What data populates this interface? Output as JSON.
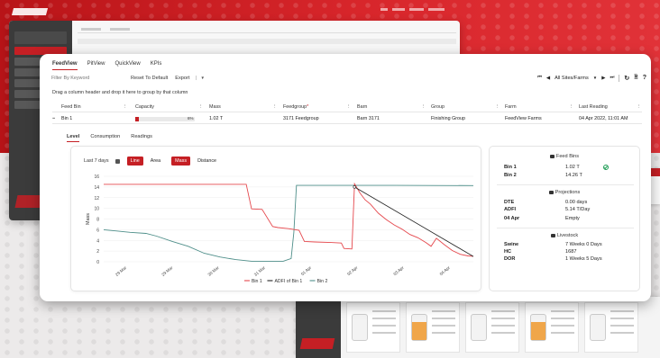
{
  "brand": {
    "accent": "#c51f24"
  },
  "tabs": [
    {
      "label": "FeedView",
      "active": true
    },
    {
      "label": "PitView",
      "active": false
    },
    {
      "label": "QuickView",
      "active": false
    },
    {
      "label": "KPIs",
      "active": false
    }
  ],
  "toolbar": {
    "filter_placeholder": "Filter By Keyword",
    "reset_label": "Reset To Default",
    "export_label": "Export",
    "export_caret": "▼",
    "first_icon": "⏮",
    "prev_icon": "◀",
    "site_label": "All Sites/Farms",
    "site_caret": "▼",
    "next_icon": "▶",
    "last_icon": "⏭",
    "refresh_icon": "↻",
    "file_icon": "🗎",
    "help_icon": "?"
  },
  "group_hint": "Drag a column header and drop it here to group by that column",
  "grid": {
    "headers": [
      "Feed Bin",
      "Capacity",
      "Mass",
      "Feedgroup",
      "Barn",
      "Group",
      "Farm",
      "Last Reading"
    ],
    "required_marker": "*",
    "row": {
      "expand_icon": "−",
      "feed_bin": "Bin 1",
      "capacity_pct": 6,
      "capacity_text": "6%",
      "mass": "1.02 T",
      "feedgroup": "3171 Feedgroup",
      "barn": "Barn 3171",
      "group": "Finishing Group",
      "farm": "FeedView Farms",
      "last_reading": "04 Apr 2022, 11:01 AM"
    }
  },
  "sub_tabs": [
    {
      "label": "Level",
      "active": true
    },
    {
      "label": "Consumption",
      "active": false
    },
    {
      "label": "Readings",
      "active": false
    }
  ],
  "chart_controls": {
    "range": "Last 7 days",
    "line_label": "Line",
    "area_label": "Area",
    "mass_label": "Mass",
    "distance_label": "Distance"
  },
  "chart_data": {
    "type": "line",
    "ylabel": "Mass",
    "xlabel": "",
    "ylim": [
      0,
      16
    ],
    "yticks": [
      0,
      2,
      4,
      6,
      8,
      10,
      12,
      14,
      16
    ],
    "x_ticks": [
      "29 Mar",
      "29 Mar",
      "30 Mar",
      "31 Mar",
      "01 Apr",
      "02 Apr",
      "03 Apr",
      "04 Apr"
    ],
    "x_range": [
      0,
      7
    ],
    "grid": true,
    "legend_position": "bottom",
    "series": [
      {
        "name": "Bin 1",
        "color": "#e5484d",
        "x": [
          0.0,
          2.7,
          2.8,
          3.0,
          3.2,
          3.3,
          3.5,
          3.7,
          3.8,
          4.0,
          4.3,
          4.5,
          4.55,
          4.7,
          4.75,
          4.85,
          4.95,
          5.05,
          5.2,
          5.35,
          5.5,
          5.65,
          5.8,
          5.95,
          6.1,
          6.2,
          6.3,
          6.45,
          6.6,
          6.75,
          6.9,
          7.0
        ],
        "y": [
          14.5,
          14.5,
          9.9,
          9.8,
          6.6,
          6.4,
          6.2,
          5.9,
          3.8,
          3.7,
          3.6,
          3.5,
          2.5,
          2.4,
          14.6,
          12.9,
          11.6,
          10.8,
          9.1,
          7.9,
          6.9,
          6.1,
          5.1,
          4.5,
          3.6,
          2.9,
          4.4,
          3.2,
          2.1,
          1.4,
          1.1,
          1.02
        ]
      },
      {
        "name": "ADFI of Bin 1",
        "color": "#222222",
        "x": [
          4.75,
          7.0
        ],
        "y": [
          14.0,
          1.0
        ]
      },
      {
        "name": "Bin 2",
        "color": "#4f8f8a",
        "x": [
          0.0,
          0.5,
          0.8,
          1.0,
          1.3,
          1.6,
          1.9,
          2.2,
          2.5,
          2.8,
          3.05,
          3.2,
          3.4,
          3.55,
          3.6,
          3.65,
          4.0,
          5.5,
          7.0
        ],
        "y": [
          6.0,
          5.5,
          5.3,
          4.8,
          3.8,
          2.9,
          1.6,
          0.9,
          0.4,
          0.1,
          0.1,
          0.1,
          0.1,
          0.6,
          5.5,
          14.3,
          14.3,
          14.3,
          14.26
        ]
      }
    ]
  },
  "info": {
    "feed_bins_title": "Feed Bins",
    "bins": [
      {
        "name": "Bin 1",
        "value": "1.02 T",
        "status_icon": "check-circle-icon"
      },
      {
        "name": "Bin 2",
        "value": "14.26 T"
      }
    ],
    "projections_title": "Projections",
    "projections": [
      {
        "key": "DTE",
        "value": "0.00 days"
      },
      {
        "key": "ADFI",
        "value": "5.14 T/Day"
      },
      {
        "key": "04 Apr",
        "value": "Empty"
      }
    ],
    "livestock_title": "Livestock",
    "livestock": [
      {
        "key": "Swine",
        "value": "7 Weeks 0 Days"
      },
      {
        "key": "HC",
        "value": "1687"
      },
      {
        "key": "DOR",
        "value": "1 Weeks 5 Days"
      }
    ]
  }
}
